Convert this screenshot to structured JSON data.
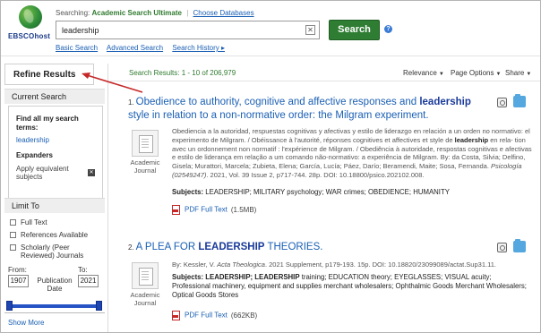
{
  "header": {
    "logo_text": "EBSCOhost",
    "searching_label": "Searching:",
    "database": "Academic Search Ultimate",
    "choose_databases": "Choose Databases",
    "search_value": "leadership",
    "search_button": "Search",
    "help": "?",
    "links": [
      "Basic Search",
      "Advanced Search",
      "Search History ▸"
    ]
  },
  "sidebar": {
    "refine_title": "Refine Results",
    "current_search_title": "Current Search",
    "find_all_label": "Find all my search terms:",
    "search_term": "leadership",
    "expanders_label": "Expanders",
    "apply_equivalent": "Apply equivalent subjects",
    "limit_to_title": "Limit To",
    "limiters": [
      "Full Text",
      "References Available",
      "Scholarly (Peer Reviewed) Journals"
    ],
    "from_label": "From:",
    "to_label": "To:",
    "from_value": "1907",
    "to_value": "2021",
    "publication_date_label": "Publication Date",
    "show_more": "Show More"
  },
  "results_bar": {
    "count_text": "Search Results: 1 - 10 of 206,979",
    "relevance": "Relevance",
    "page_options": "Page Options",
    "share": "Share"
  },
  "results": [
    {
      "number": "1.",
      "title_pre": "Obedience to authority, cognitive and affective responses and ",
      "title_bold": "leadership",
      "title_post": " style in relation to a non-normative order: the Milgram experiment.",
      "type": "Academic Journal",
      "abstract_1": "Obediencia a la autoridad, respuestas cognitivas y afectivas y estilo de liderazgo en relación a un orden no normativo: el experimento de Milgram. / Obéissance à l'autorité, réponses cognitives et affectives et style de ",
      "abstract_bold": "leadership",
      "abstract_2": " en rela- tion avec un ordonnement non normatif : l'expérience de Milgram. / Obediência à autoridade, respostas cognitivas e afectivas e estilo de liderança em relação a um comando não-normativo: a experiência de Milgram. By: da Costa, Silvia; Delfino, Gisela; Murattori, Marcela; Zubieta, Elena; García, Lucía; Páez, Darío; Beramendi, Maite; Sosa, Fernanda. ",
      "journal": "Psicología (02549247)",
      "abstract_3": ". 2021, Vol. 39 Issue 2, p717-744. 28p. DOI: 10.18800/psico.202102.008.",
      "subjects_label": "Subjects:",
      "subjects": "LEADERSHIP; MILITARY psychology; WAR crimes; OBEDIENCE; HUMANITY",
      "pdf_label": "PDF Full Text",
      "pdf_size": "(1.5MB)"
    },
    {
      "number": "2.",
      "title_pre": "A PLEA FOR ",
      "title_bold": "LEADERSHIP",
      "title_post": " THEORIES.",
      "type": "Academic Journal",
      "abstract_1": "By: Kessler, V. ",
      "journal": "Acta Theologica",
      "abstract_3": ". 2021 Supplement, p179-193. 15p. DOI: 10.18820/23099089/actat.Sup31.11.",
      "subjects_label": "Subjects:",
      "subjects_bold": "LEADERSHIP; LEADERSHIP",
      "subjects": " training; EDUCATION theory; EYEGLASSES; VISUAL acuity; Professional machinery, equipment and supplies merchant wholesalers; Ophthalmic Goods Merchant Wholesalers; Optical Goods Stores",
      "pdf_label": "PDF Full Text",
      "pdf_size": "(662KB)"
    }
  ],
  "colors": {
    "search_button": "#2e7d32",
    "link": "#1a5fb4",
    "result_count": "#2f7a2f",
    "arrow": "#c62828"
  }
}
